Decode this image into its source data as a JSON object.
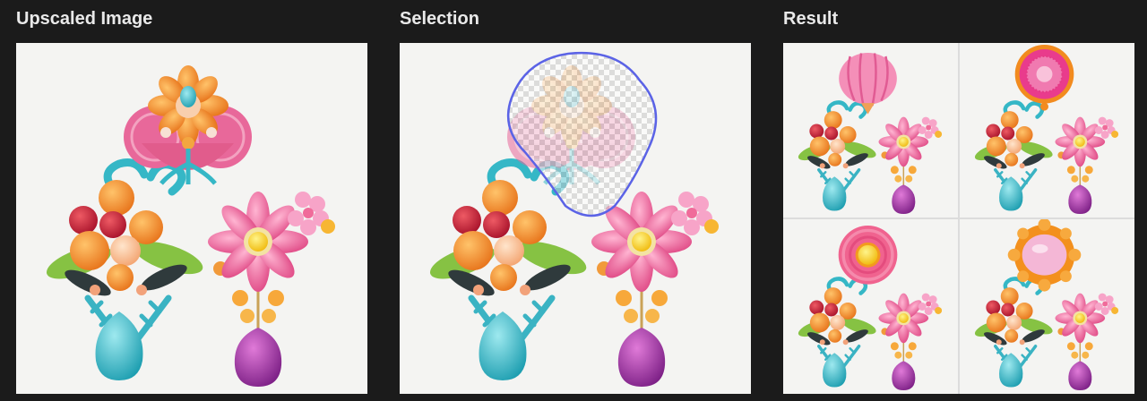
{
  "panels": {
    "upscaled": {
      "title": "Upscaled Image"
    },
    "selection": {
      "title": "Selection",
      "outline_color": "#5b63e6"
    },
    "result": {
      "title": "Result",
      "variations": [
        {
          "name": "variation-1",
          "top_element": "pink-striped-balloon"
        },
        {
          "name": "variation-2",
          "top_element": "magenta-ruffled-rosette"
        },
        {
          "name": "variation-3",
          "top_element": "pink-spiral-with-yellow-center"
        },
        {
          "name": "variation-4",
          "top_element": "pink-gem-with-orange-petals"
        }
      ]
    }
  },
  "colors": {
    "background": "#1b1b1b",
    "canvas": "#f4f4f2",
    "title_text": "#e9e9e9",
    "pink": "#e9659a",
    "orange": "#f39129",
    "teal": "#36b9c8",
    "purple": "#a23b9e",
    "green": "#7dbb3c",
    "yellow": "#f6d411"
  }
}
